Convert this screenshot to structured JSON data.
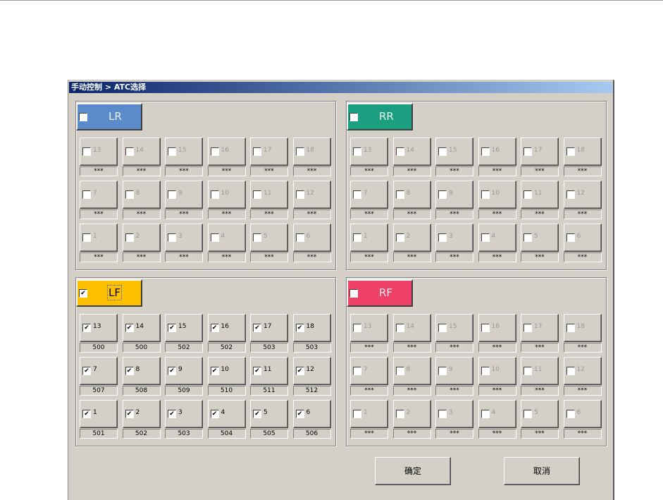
{
  "window": {
    "title": "手动控制 > ATC选择"
  },
  "groups": [
    {
      "id": "lr",
      "label": "LR",
      "checked": false,
      "color": "#5b8bcb",
      "values": {
        "13": "***",
        "14": "***",
        "15": "***",
        "16": "***",
        "17": "***",
        "18": "***",
        "7": "***",
        "8": "***",
        "9": "***",
        "10": "***",
        "11": "***",
        "12": "***",
        "1": "***",
        "2": "***",
        "3": "***",
        "4": "***",
        "5": "***",
        "6": "***"
      }
    },
    {
      "id": "rr",
      "label": "RR",
      "checked": false,
      "color": "#1a9f80",
      "values": {
        "13": "***",
        "14": "***",
        "15": "***",
        "16": "***",
        "17": "***",
        "18": "***",
        "7": "***",
        "8": "***",
        "9": "***",
        "10": "***",
        "11": "***",
        "12": "***",
        "1": "***",
        "2": "***",
        "3": "***",
        "4": "***",
        "5": "***",
        "6": "***"
      }
    },
    {
      "id": "lf",
      "label": "LF",
      "checked": true,
      "color": "#ffc000",
      "values": {
        "13": "500",
        "14": "500",
        "15": "502",
        "16": "502",
        "17": "503",
        "18": "503",
        "7": "507",
        "8": "508",
        "9": "509",
        "10": "510",
        "11": "511",
        "12": "512",
        "1": "501",
        "2": "502",
        "3": "503",
        "4": "504",
        "5": "505",
        "6": "506"
      }
    },
    {
      "id": "rf",
      "label": "RF",
      "checked": false,
      "color": "#ef4068",
      "values": {
        "13": "***",
        "14": "***",
        "15": "***",
        "16": "***",
        "17": "***",
        "18": "***",
        "7": "***",
        "8": "***",
        "9": "***",
        "10": "***",
        "11": "***",
        "12": "***",
        "1": "***",
        "2": "***",
        "3": "***",
        "4": "***",
        "5": "***",
        "6": "***"
      }
    }
  ],
  "rows": [
    [
      "13",
      "14",
      "15",
      "16",
      "17",
      "18"
    ],
    [
      "7",
      "8",
      "9",
      "10",
      "11",
      "12"
    ],
    [
      "1",
      "2",
      "3",
      "4",
      "5",
      "6"
    ]
  ],
  "buttons": {
    "ok": "确定",
    "cancel": "取消"
  }
}
